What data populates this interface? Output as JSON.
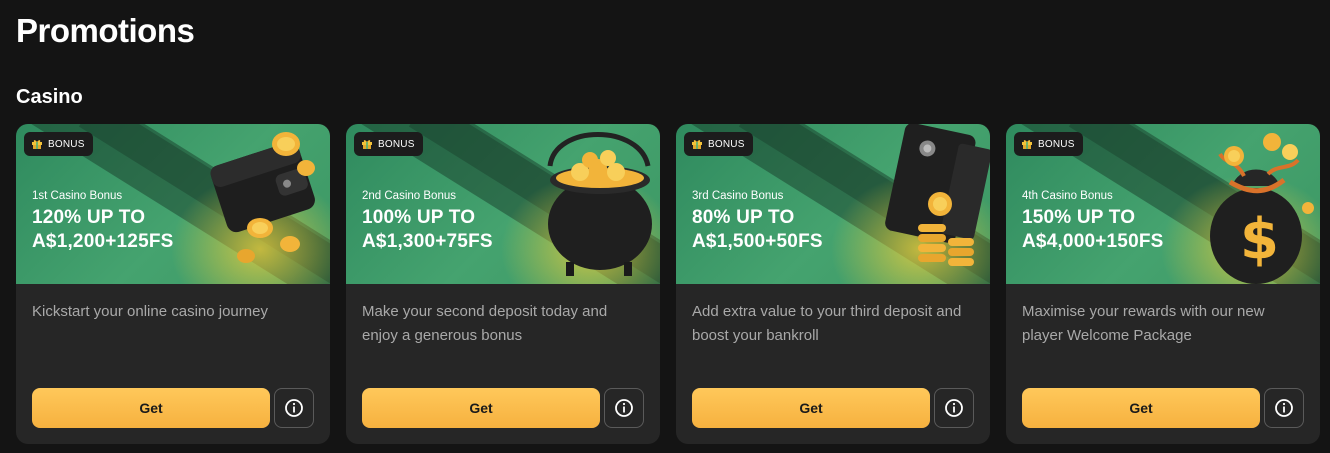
{
  "page": {
    "title": "Promotions"
  },
  "section": {
    "title": "Casino"
  },
  "colors": {
    "background": "#141414",
    "card": "#262626",
    "banner_green": "#45a36f",
    "button_gold": "#ffc85a"
  },
  "cards": [
    {
      "badge": "BONUS",
      "subtitle": "1st Casino Bonus",
      "title_line1": "120% UP TO",
      "title_line2": "A$1,200+125FS",
      "description": "Kickstart your online casino journey",
      "button": "Get",
      "art": "wallet-with-coins"
    },
    {
      "badge": "BONUS",
      "subtitle": "2nd Casino Bonus",
      "title_line1": "100% UP TO",
      "title_line2": "A$1,300+75FS",
      "description": "Make your second deposit today and enjoy a generous bonus",
      "button": "Get",
      "art": "pot-of-gold"
    },
    {
      "badge": "BONUS",
      "subtitle": "3rd Casino Bonus",
      "title_line1": "80% UP TO",
      "title_line2": "A$1,500+50FS",
      "description": "Add extra value to your third deposit and boost your bankroll",
      "button": "Get",
      "art": "safe-with-coins"
    },
    {
      "badge": "BONUS",
      "subtitle": "4th Casino Bonus",
      "title_line1": "150% UP TO",
      "title_line2": "A$4,000+150FS",
      "description": "Maximise your rewards with our new player Welcome Package",
      "button": "Get",
      "art": "money-bag"
    }
  ]
}
